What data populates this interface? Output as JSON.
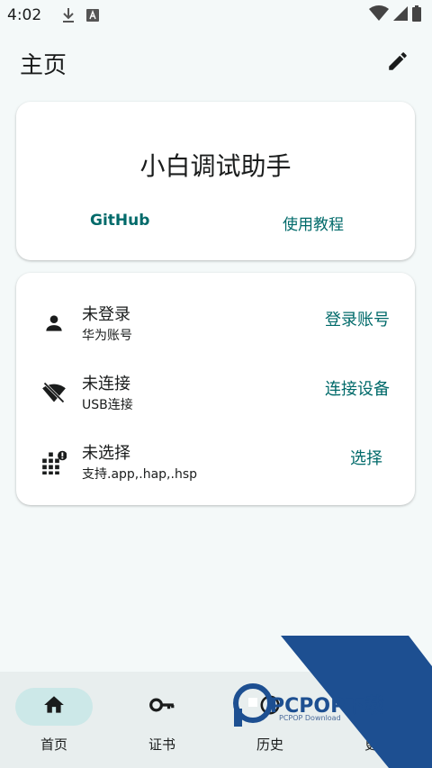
{
  "status_bar": {
    "time": "4:02",
    "icons": [
      "download-icon",
      "font-a-icon",
      "wifi-icon",
      "signal-icon",
      "battery-icon"
    ]
  },
  "app_bar": {
    "title": "主页",
    "edit_icon": "pencil-icon"
  },
  "header_card": {
    "app_name": "小白调试助手",
    "links": {
      "github": "GitHub",
      "tutorial": "使用教程"
    }
  },
  "status_card": {
    "rows": [
      {
        "icon": "person-icon",
        "title": "未登录",
        "subtitle": "华为账号",
        "action": "登录账号"
      },
      {
        "icon": "wifi-off-icon",
        "title": "未连接",
        "subtitle": "USB连接",
        "action": "连接设备"
      },
      {
        "icon": "apps-alert-icon",
        "title": "未选择",
        "subtitle": "支持.app,.hap,.hsp",
        "action": "选择"
      }
    ]
  },
  "bottom_nav": {
    "items": [
      {
        "label": "首页",
        "icon": "home-icon",
        "active": true
      },
      {
        "label": "证书",
        "icon": "key-icon",
        "active": false
      },
      {
        "label": "历史",
        "icon": "history-icon",
        "active": false
      },
      {
        "label": "更多",
        "icon": "more-icon",
        "active": false
      }
    ]
  },
  "watermark": {
    "text": "PCPOP下载",
    "sub": "PCPOP Download"
  },
  "colors": {
    "background": "#f4f9f9",
    "accent": "#006a6a",
    "nav_bg": "#e8eeee",
    "nav_active_pill": "#cce8e8",
    "watermark_blue": "#1d4f91"
  }
}
